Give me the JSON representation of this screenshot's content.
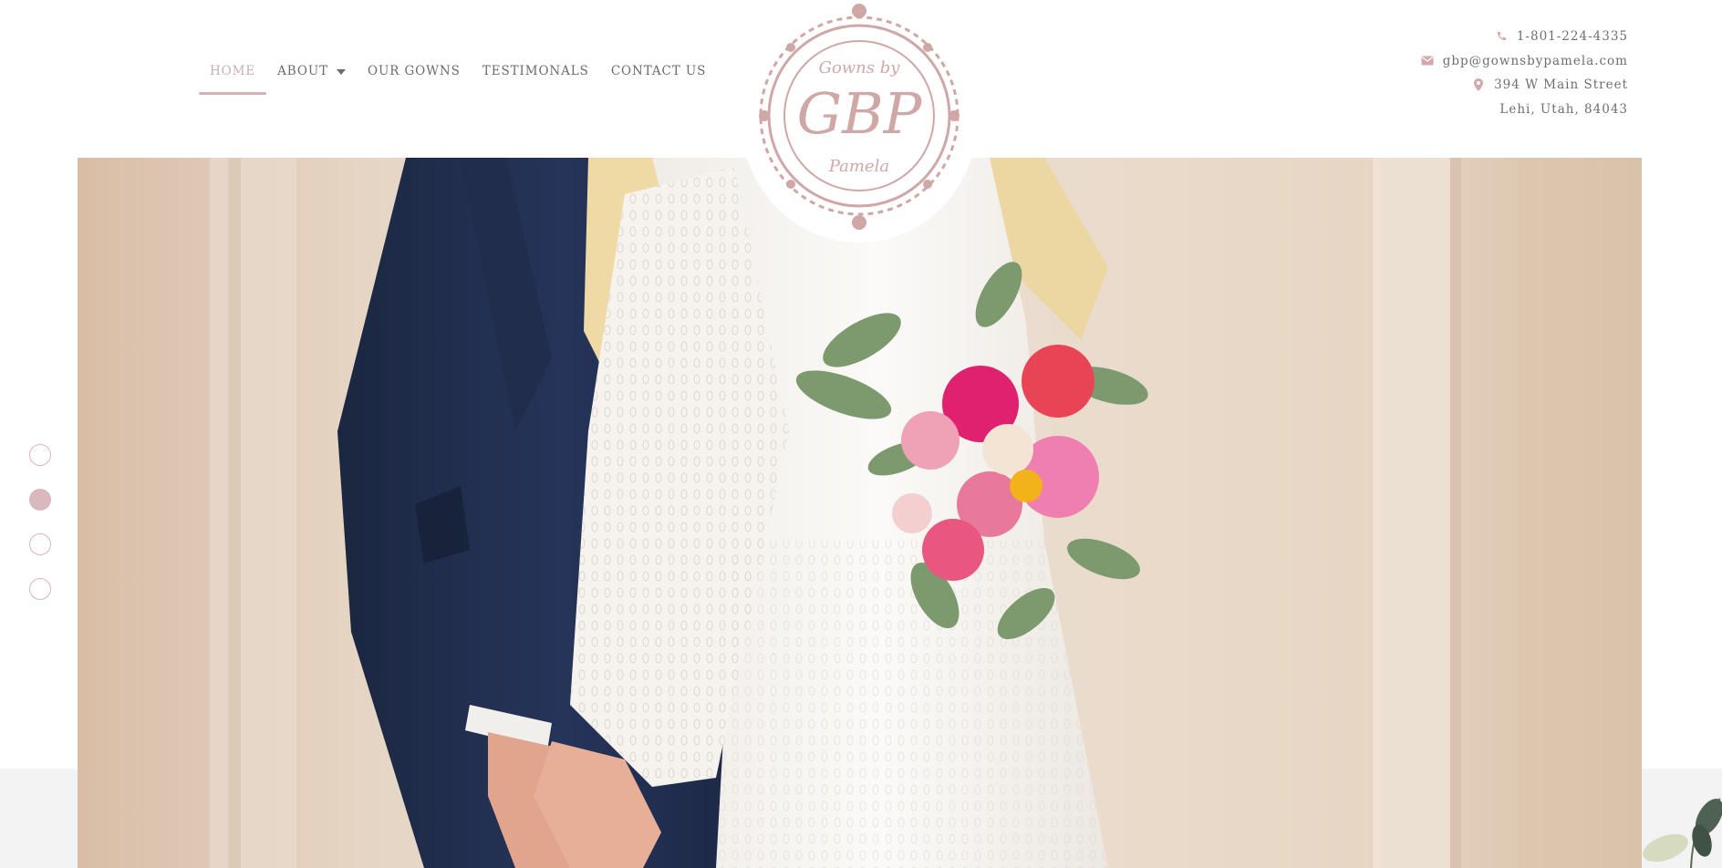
{
  "site": {
    "brand_name": "Gowns by GBP Pamela"
  },
  "nav": {
    "items": [
      {
        "label": "HOME",
        "active": true
      },
      {
        "label": "ABOUT",
        "has_dropdown": true
      },
      {
        "label": "OUR GOWNS"
      },
      {
        "label": "TESTIMONALS"
      },
      {
        "label": "CONTACT US"
      }
    ]
  },
  "logo": {
    "line_top": "Gowns by",
    "monogram": "GBP",
    "line_bottom": "Pamela",
    "color": "#cfa7a7"
  },
  "contact": {
    "phone": "1-801-224-4335",
    "email": "gbp@gownsbypamela.com",
    "street": "394 W Main Street",
    "city": "Lehi, Utah, 84043",
    "icons": [
      "phone-icon",
      "envelope-icon",
      "map-pin-icon"
    ]
  },
  "slider": {
    "slide_count": 4,
    "active_index": 1
  },
  "colors": {
    "accent": "#d3b2b4",
    "nav_active": "#c9aeae",
    "text": "#6b6b6b",
    "band": "#f3f3f3"
  }
}
